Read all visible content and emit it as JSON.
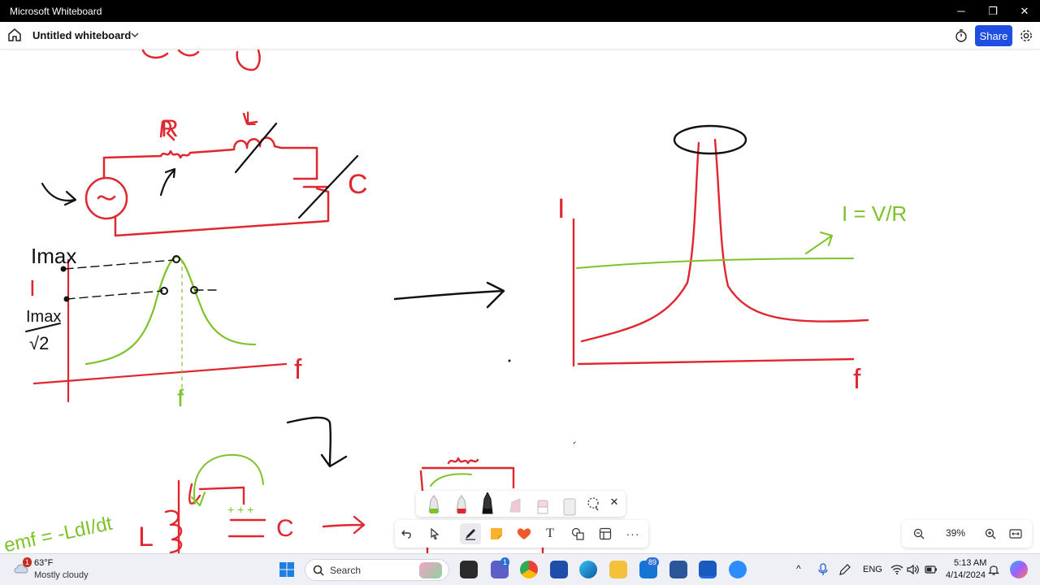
{
  "titlebar": {
    "app_title": "Microsoft Whiteboard"
  },
  "appbar": {
    "document_title": "Untitled whiteboard",
    "share_label": "Share"
  },
  "canvas": {
    "labels": {
      "r": "R",
      "l": "L",
      "c": "C",
      "i_axis": "I",
      "i_max": "Imax",
      "i_max_sqrt2_num": "Imax",
      "i_max_sqrt2_den": "√2",
      "f_axis": "f",
      "f_center": "f",
      "i_right": "I",
      "f_right": "f",
      "i_eq": "I = V/R",
      "emf": "emf = -LdI/dt",
      "l_bottom": "L",
      "c_bottom": "C",
      "plus": "+ + +"
    }
  },
  "zoom": {
    "level": "39%"
  },
  "taskbar": {
    "weather_temp": "63°F",
    "weather_desc": "Mostly cloudy",
    "weather_badge": "1",
    "search_placeholder": "Search",
    "teams_badge": "1",
    "mail_badge": "89",
    "lang": "ENG",
    "time": "5:13 AM",
    "date": "4/14/2024"
  },
  "colors": {
    "red_ink": "#e0262e",
    "green_ink": "#7ec22a",
    "black_ink": "#111111",
    "share": "#1f4fe0"
  }
}
